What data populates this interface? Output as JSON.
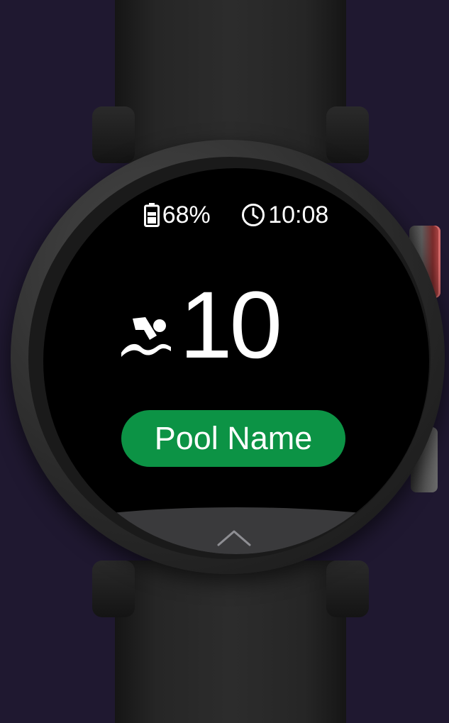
{
  "status": {
    "battery_percent": "68%",
    "time": "10:08",
    "battery_icon": "battery-icon",
    "clock_icon": "clock-icon"
  },
  "workout": {
    "icon": "swimmer-icon",
    "lap_count": "10"
  },
  "pool": {
    "name": "Pool Name",
    "color": "#0c9345"
  },
  "tray": {
    "icon": "chevron-up-icon"
  }
}
